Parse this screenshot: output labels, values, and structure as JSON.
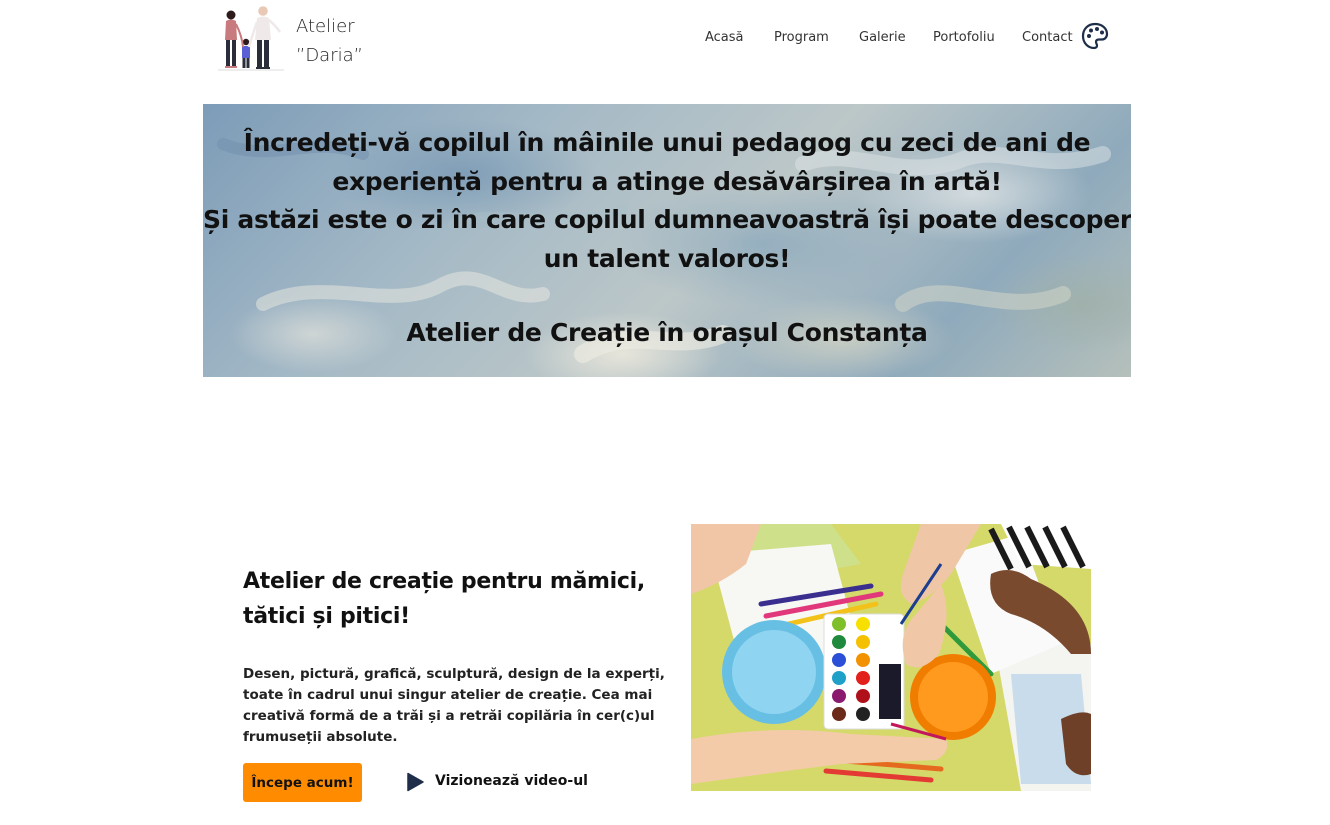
{
  "header": {
    "brand_line1": "Atelier",
    "brand_line2": "”Daria”",
    "logo_icon": "family-illustration-icon",
    "palette_icon": "palette-icon",
    "nav": {
      "acasa": "Acasă",
      "program": "Program",
      "galerie": "Galerie",
      "portofoliu": "Portofoliu",
      "contact": "Contact"
    }
  },
  "hero": {
    "line1": "Încredeți-vă copilul în mâinile unui pedagog cu zeci de ani de",
    "line2": "experiență pentru a atinge desăvârșirea în artă!",
    "line3": "Și astăzi este o zi în care copilul dumneavoastră își poate descoperi",
    "line4": "un talent valoros!",
    "subtitle": "Atelier de Creație în orașul Constanța"
  },
  "feature": {
    "title_line1": "Atelier de creație pentru mămici,",
    "title_line2": "tătici și pitici!",
    "desc_line1": "Desen, pictură, grafică, sculptură, design de la experți,",
    "desc_line2": "toate în cadrul unui singur atelier de creație. Cea mai",
    "desc_line3": "creativă formă de a trăi și a retrăi copilăria în cer(c)ul",
    "desc_line4": "frumuseții absolute.",
    "start_button": "Începe acum!",
    "video_link": "Vizionează video-ul",
    "play_icon": "play-icon",
    "image_subject": "children-painting-with-watercolors"
  },
  "colors": {
    "accent": "#ff8c00",
    "play_icon": "#1f2f4a",
    "text": "#111111"
  }
}
